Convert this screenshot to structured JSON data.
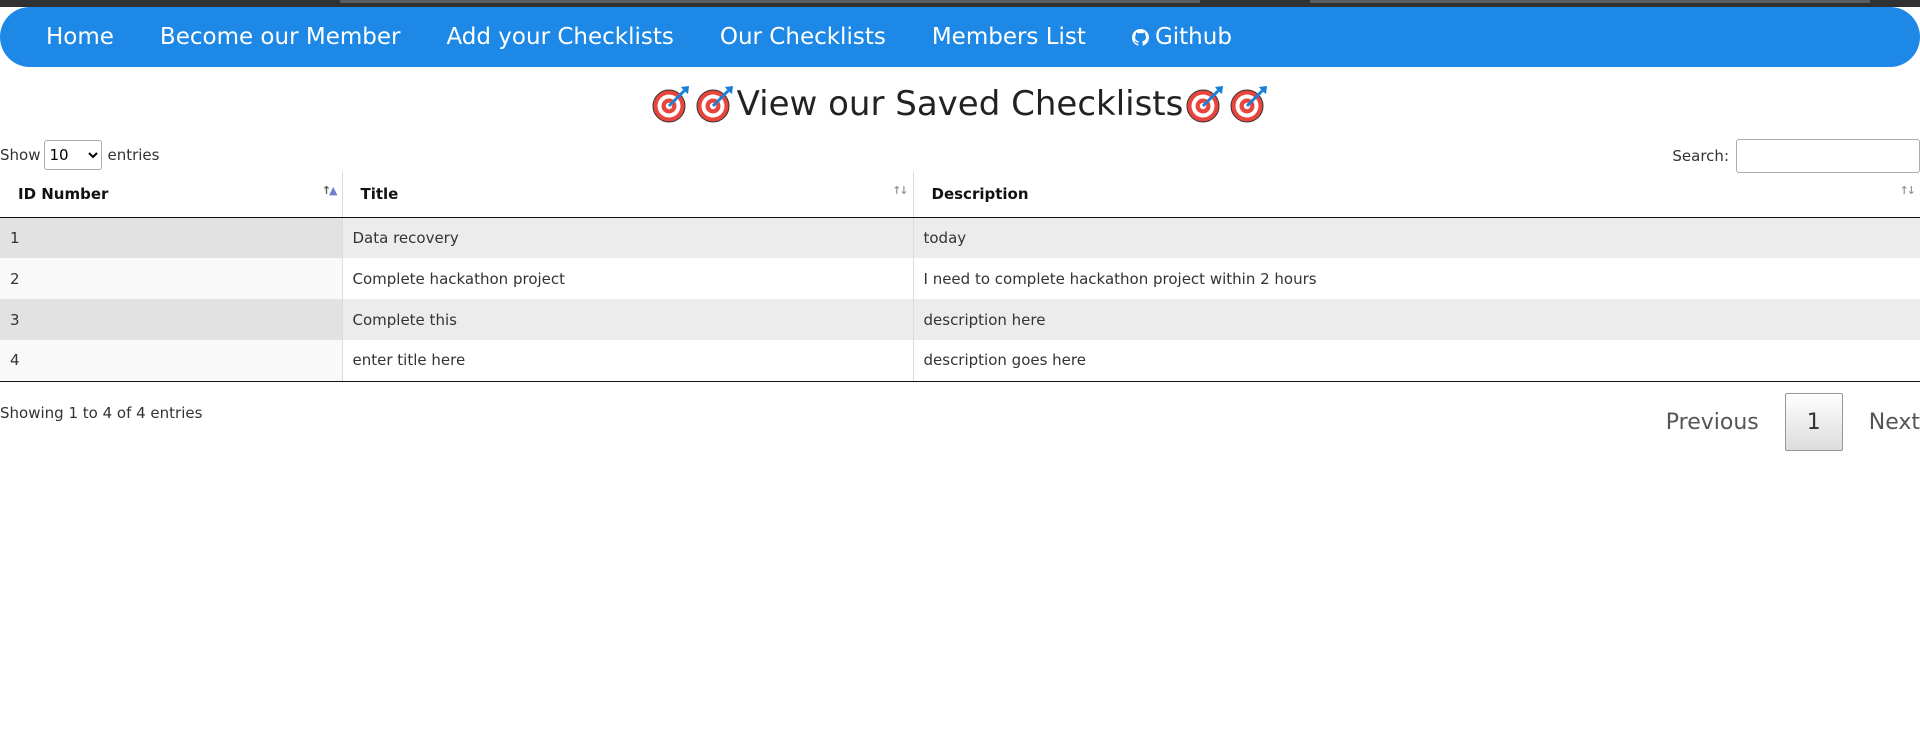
{
  "nav": {
    "items": [
      {
        "label": "Home"
      },
      {
        "label": "Become our Member"
      },
      {
        "label": "Add your Checklists"
      },
      {
        "label": "Our Checklists"
      },
      {
        "label": "Members List"
      },
      {
        "label": "Github",
        "icon": "github-icon"
      }
    ]
  },
  "title": {
    "text": "View our Saved Checklists",
    "icons": [
      "target-icon",
      "target-icon",
      "target-icon",
      "target-icon"
    ]
  },
  "length": {
    "show_label": "Show",
    "value": "10",
    "options": [
      "10"
    ],
    "entries_label": "entries"
  },
  "search": {
    "label": "Search:",
    "value": ""
  },
  "table": {
    "columns": [
      "ID Number",
      "Title",
      "Description"
    ],
    "sorted_column": "ID Number",
    "sort_direction": "ascending",
    "rows": [
      {
        "id": "1",
        "title": "Data recovery",
        "description": "today"
      },
      {
        "id": "2",
        "title": "Complete hackathon project",
        "description": "I need to complete hackathon project within 2 hours"
      },
      {
        "id": "3",
        "title": "Complete this",
        "description": "description here"
      },
      {
        "id": "4",
        "title": "enter title here",
        "description": "description goes here"
      }
    ]
  },
  "info": "Showing 1 to 4 of 4 entries",
  "pagination": {
    "previous": "Previous",
    "current": "1",
    "next": "Next"
  },
  "colors": {
    "navbar": "#1d88e5",
    "odd_row": "#ececec",
    "sort_arrow_active": "#6f7fd0"
  }
}
